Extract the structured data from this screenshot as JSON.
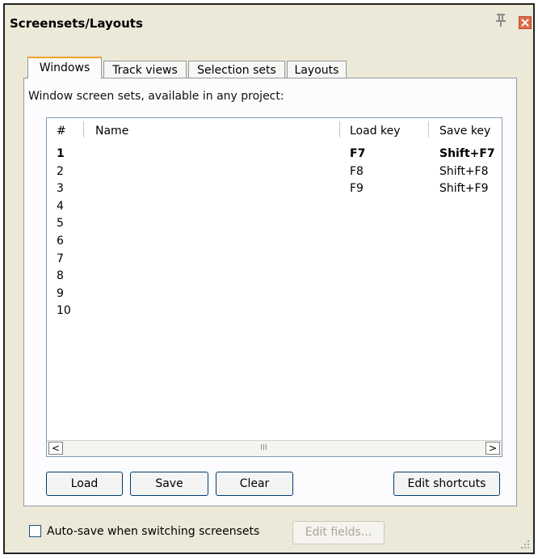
{
  "window": {
    "title": "Screensets/Layouts"
  },
  "tabs": [
    {
      "label": "Windows",
      "active": true
    },
    {
      "label": "Track views",
      "active": false
    },
    {
      "label": "Selection sets",
      "active": false
    },
    {
      "label": "Layouts",
      "active": false
    }
  ],
  "caption": "Window screen sets, available in any project:",
  "table": {
    "columns": [
      "#",
      "Name",
      "Load key",
      "Save key"
    ],
    "rows": [
      {
        "num": "1",
        "name": "",
        "load": "F7",
        "save": "Shift+F7",
        "bold": true
      },
      {
        "num": "2",
        "name": "",
        "load": "F8",
        "save": "Shift+F8"
      },
      {
        "num": "3",
        "name": "",
        "load": "F9",
        "save": "Shift+F9"
      },
      {
        "num": "4",
        "name": "",
        "load": "",
        "save": ""
      },
      {
        "num": "5",
        "name": "",
        "load": "",
        "save": ""
      },
      {
        "num": "6",
        "name": "",
        "load": "",
        "save": ""
      },
      {
        "num": "7",
        "name": "",
        "load": "",
        "save": ""
      },
      {
        "num": "8",
        "name": "",
        "load": "",
        "save": ""
      },
      {
        "num": "9",
        "name": "",
        "load": "",
        "save": ""
      },
      {
        "num": "10",
        "name": "",
        "load": "",
        "save": ""
      }
    ]
  },
  "buttons": {
    "load": "Load",
    "save": "Save",
    "clear": "Clear",
    "edit_shortcuts": "Edit shortcuts"
  },
  "footer": {
    "autosave_label": "Auto-save when switching screensets",
    "autosave_checked": false,
    "edit_fields": "Edit fields..."
  },
  "scrollbar": {
    "left": "<",
    "right": ">",
    "grip": "III"
  },
  "colors": {
    "active_tab_accent": "#f0a030",
    "close_button": "#e06a4a"
  },
  "icons": [
    "pin-icon",
    "close-icon",
    "resize-grip-icon"
  ]
}
